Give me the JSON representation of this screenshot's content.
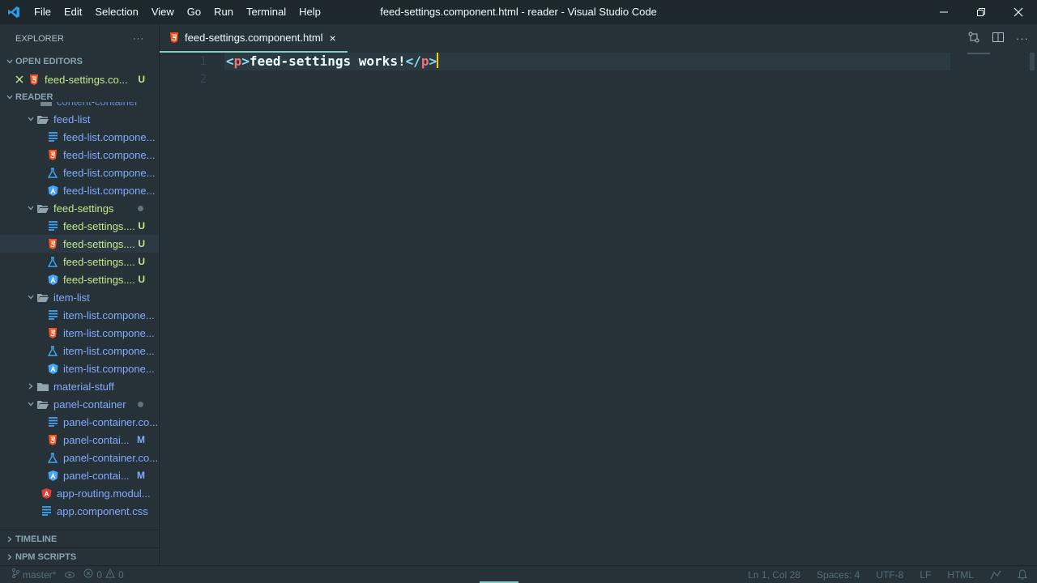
{
  "window": {
    "title": "feed-settings.component.html - reader - Visual Studio Code",
    "menu": [
      "File",
      "Edit",
      "Selection",
      "View",
      "Go",
      "Run",
      "Terminal",
      "Help"
    ]
  },
  "sidebar": {
    "header": "EXPLORER",
    "open_editors": {
      "label": "OPEN EDITORS",
      "items": [
        {
          "name": "feed-settings.co...",
          "badge": "U"
        }
      ]
    },
    "reader": {
      "label": "READER",
      "items": [
        {
          "name": "content-container",
          "badge": ""
        },
        {
          "name": "feed-list",
          "badge": ""
        },
        {
          "name": "feed-list.compone...",
          "badge": ""
        },
        {
          "name": "feed-list.compone...",
          "badge": ""
        },
        {
          "name": "feed-list.compone...",
          "badge": ""
        },
        {
          "name": "feed-list.compone...",
          "badge": ""
        },
        {
          "name": "feed-settings",
          "badge": ""
        },
        {
          "name": "feed-settings....",
          "badge": "U"
        },
        {
          "name": "feed-settings....",
          "badge": "U"
        },
        {
          "name": "feed-settings....",
          "badge": "U"
        },
        {
          "name": "feed-settings....",
          "badge": "U"
        },
        {
          "name": "item-list",
          "badge": ""
        },
        {
          "name": "item-list.compone...",
          "badge": ""
        },
        {
          "name": "item-list.compone...",
          "badge": ""
        },
        {
          "name": "item-list.compone...",
          "badge": ""
        },
        {
          "name": "item-list.compone...",
          "badge": ""
        },
        {
          "name": "material-stuff",
          "badge": ""
        },
        {
          "name": "panel-container",
          "badge": ""
        },
        {
          "name": "panel-container.co...",
          "badge": ""
        },
        {
          "name": "panel-contai...",
          "badge": "M"
        },
        {
          "name": "panel-container.co...",
          "badge": ""
        },
        {
          "name": "panel-contai...",
          "badge": "M"
        },
        {
          "name": "app-routing.modul...",
          "badge": ""
        },
        {
          "name": "app.component.css",
          "badge": ""
        }
      ]
    },
    "timeline": "TIMELINE",
    "npm_scripts": "NPM SCRIPTS"
  },
  "tab": {
    "label": "feed-settings.component.html",
    "close": "×"
  },
  "editor": {
    "line_numbers": [
      "1",
      "2"
    ],
    "tokens": [
      {
        "t": "<",
        "k": "tk-bracket"
      },
      {
        "t": "p",
        "k": "tk-tag"
      },
      {
        "t": ">",
        "k": "tk-bracket"
      },
      {
        "t": "feed-settings works!",
        "k": "tk-text"
      },
      {
        "t": "</",
        "k": "tk-bracket"
      },
      {
        "t": "p",
        "k": "tk-tag"
      },
      {
        "t": ">",
        "k": "tk-bracket"
      }
    ]
  },
  "statusbar": {
    "branch": "master*",
    "errors": "0",
    "warnings": "0",
    "position": "Ln 1, Col 28",
    "spaces": "Spaces: 4",
    "encoding": "UTF-8",
    "eol": "LF",
    "language": "HTML"
  },
  "colors": {
    "bg": "#263238",
    "accent": "#80cbc4",
    "untracked": "#c3e88d",
    "folder": "#82aaff",
    "html_icon": "#f4511e",
    "css_icon": "#42a5f5",
    "angular_icon": "#e53935"
  }
}
